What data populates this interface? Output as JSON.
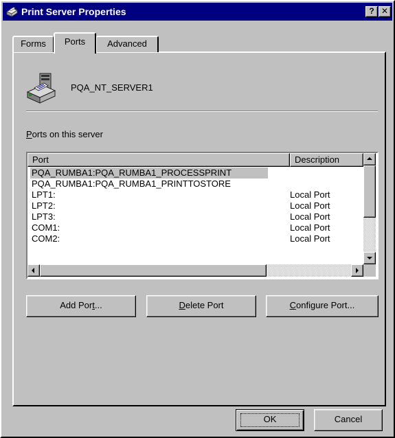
{
  "window": {
    "title": "Print Server Properties",
    "help_button": "?",
    "close_button": "✕",
    "title_icon": "printer-folder-icon"
  },
  "tabs": [
    {
      "label": "Forms",
      "selected": false
    },
    {
      "label": "Ports",
      "selected": true
    },
    {
      "label": "Advanced",
      "selected": false
    }
  ],
  "server": {
    "name": "PQA_NT_SERVER1",
    "icon": "print-server-icon"
  },
  "ports_section": {
    "label_prefix": "P",
    "label_rest": "orts on this server"
  },
  "ports_list": {
    "columns": [
      "Port",
      "Description"
    ],
    "rows": [
      {
        "port": "PQA_RUMBA1:PQA_RUMBA1_PROCESSPRINT",
        "description": "",
        "selected": true
      },
      {
        "port": "PQA_RUMBA1:PQA_RUMBA1_PRINTTOSTORE",
        "description": ""
      },
      {
        "port": "LPT1:",
        "description": "Local Port"
      },
      {
        "port": "LPT2:",
        "description": "Local Port"
      },
      {
        "port": "LPT3:",
        "description": "Local Port"
      },
      {
        "port": "COM1:",
        "description": "Local Port"
      },
      {
        "port": "COM2:",
        "description": "Local Port"
      }
    ]
  },
  "actions": {
    "add_port_pre": "Add Por",
    "add_port_ul": "t",
    "add_port_post": "...",
    "delete_port_ul": "D",
    "delete_port_post": "elete Port",
    "configure_port_ul": "C",
    "configure_port_post": "onfigure Port..."
  },
  "footer": {
    "ok_label": "OK",
    "cancel_label": "Cancel"
  },
  "colors": {
    "titlebar": "#000080",
    "face": "#c0c0c0"
  }
}
